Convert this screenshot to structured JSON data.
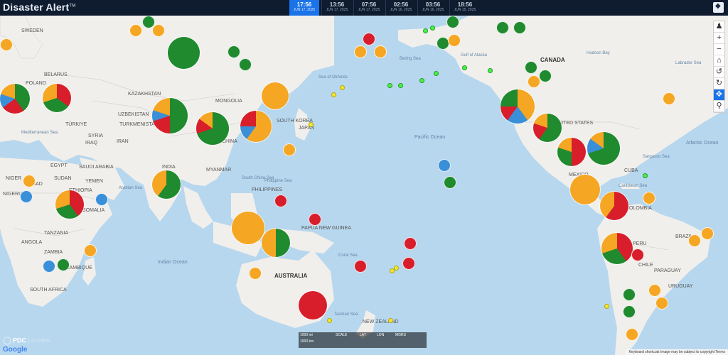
{
  "app": {
    "title": "Disaster Alert",
    "trademark": "TM"
  },
  "timeline": [
    {
      "time": "17:56",
      "date": "JUN 17, 2025",
      "active": true
    },
    {
      "time": "13:56",
      "date": "JUN 17, 2025"
    },
    {
      "time": "07:56",
      "date": "JUN 17, 2025"
    },
    {
      "time": "02:56",
      "date": "JUN 16, 2025"
    },
    {
      "time": "03:56",
      "date": "JUN 16, 2025"
    },
    {
      "time": "18:56",
      "date": "JUN 15, 2025"
    }
  ],
  "map_labels": {
    "countries": [
      "SWEDEN",
      "BELARUS",
      "POLAND",
      "KAZAKHSTAN",
      "MONGOLIA",
      "UZBEKISTAN",
      "TURKMENISTAN",
      "TÜRKIYE",
      "SYRIA",
      "IRAQ",
      "IRAN",
      "SAUDI ARABIA",
      "EGYPT",
      "SUDAN",
      "NIGER",
      "CHAD",
      "NIGERIA",
      "ETHIOPIA",
      "SOMALIA",
      "YEMEN",
      "TANZANIA",
      "ANGOLA",
      "ZAMBIA",
      "MOZAMBIQUE",
      "SOUTH AFRICA",
      "INDIA",
      "CHINA",
      "JAPAN",
      "SOUTH KOREA",
      "MYANMAR",
      "PHILIPPINES",
      "PAPUA NEW GUINEA",
      "AUSTRALIA",
      "NEW ZEALAND",
      "CANADA",
      "MEXICO",
      "CUBA",
      "COLOMBIA",
      "BRAZIL",
      "PERU",
      "CHILE",
      "PARAGUAY",
      "URUGUAY",
      "UNITED STATES"
    ],
    "oceans": [
      "Pacific Ocean",
      "Indian Ocean",
      "Atlantic Ocean"
    ],
    "seas": [
      "Bering Sea",
      "Gulf of Alaska",
      "Hudson Bay",
      "Labrador Sea",
      "Sea of Okhotsk",
      "Philippine Sea",
      "South China Sea",
      "Arabian Sea",
      "Coral Sea",
      "Tasman Sea",
      "Caribbean Sea",
      "Sargasso Sea",
      "Mediterranean Sea"
    ]
  },
  "zoom_controls": [
    "pegman-icon",
    "zoom-in-icon",
    "zoom-out-icon",
    "home-icon",
    "undo-icon",
    "redo-icon",
    "pan-icon",
    "zoom-search-icon"
  ],
  "branding": {
    "pdc": "PDC",
    "global": "GLOBAL",
    "google": "Google"
  },
  "scale": {
    "mi": "1000 mi",
    "km": "1000 km",
    "scale_label": "SCALE",
    "lat_label": "LAT",
    "lon_label": "LON",
    "mgrs_label": "MGRS"
  },
  "credits": "Keyboard shortcuts   Image may be subject to copyright   Terms",
  "colors": {
    "wildfire": "#1f8a2e",
    "flood": "#f5a623",
    "earthquake": "#d81e2b",
    "storm": "#3a8fd9",
    "topbar": "#0f1b2e",
    "active_tab": "#1a73e8"
  }
}
